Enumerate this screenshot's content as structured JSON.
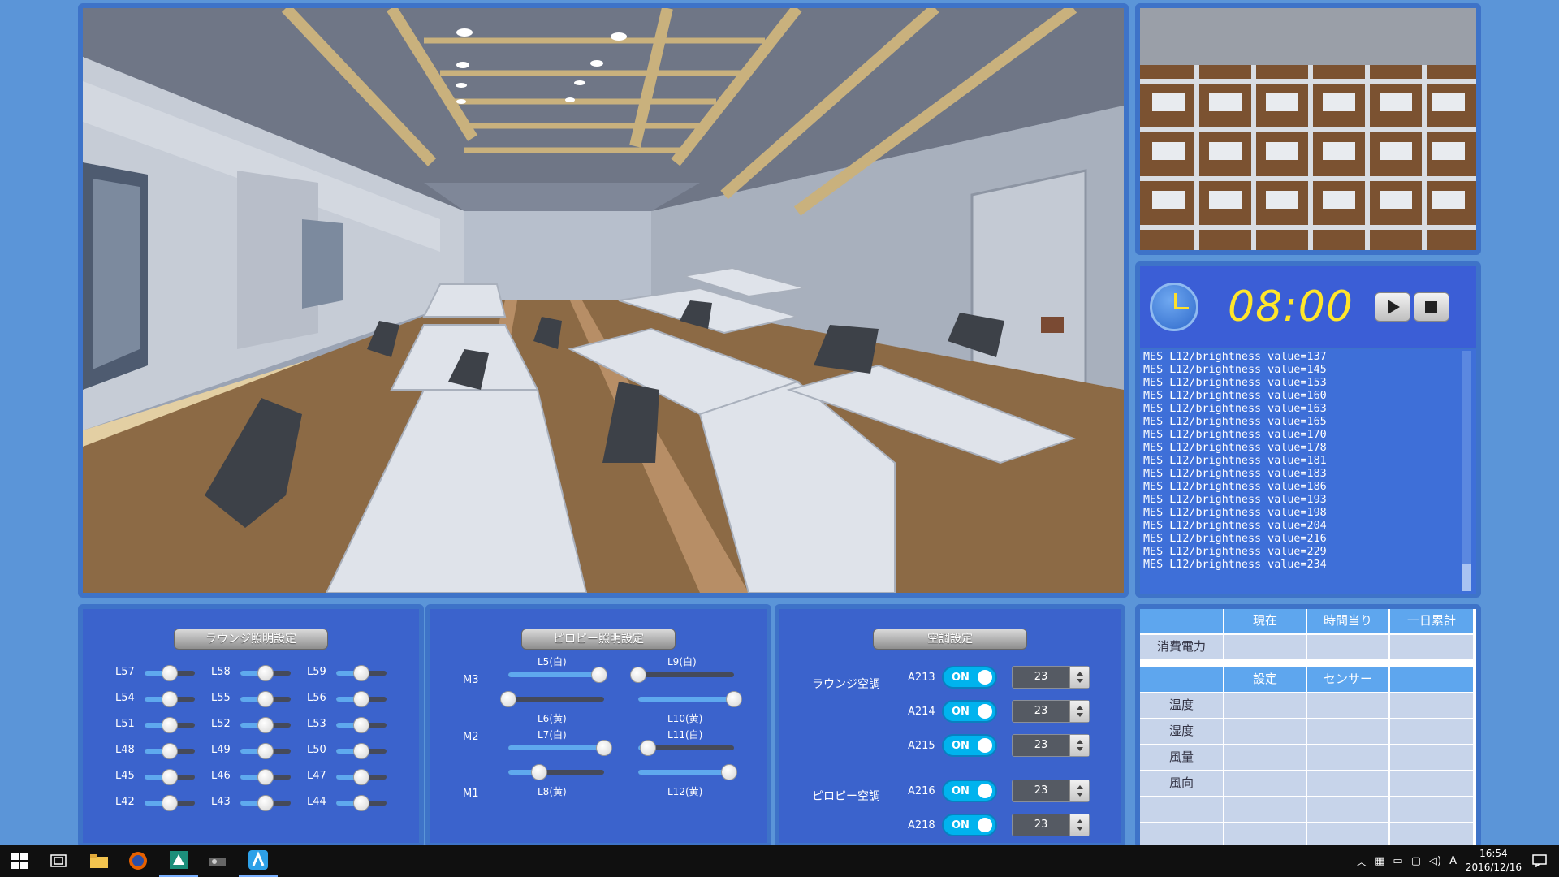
{
  "clock": {
    "time": "08:00"
  },
  "log": {
    "lines": [
      "MES L12/brightness value=137",
      "MES L12/brightness value=145",
      "MES L12/brightness value=153",
      "MES L12/brightness value=160",
      "MES L12/brightness value=163",
      "MES L12/brightness value=165",
      "MES L12/brightness value=170",
      "MES L12/brightness value=178",
      "MES L12/brightness value=181",
      "MES L12/brightness value=183",
      "MES L12/brightness value=186",
      "MES L12/brightness value=193",
      "MES L12/brightness value=198",
      "MES L12/brightness value=204",
      "MES L12/brightness value=216",
      "MES L12/brightness value=229",
      "MES L12/brightness value=234"
    ]
  },
  "lounge_lighting": {
    "title": "ラウンジ照明設定",
    "sliders": [
      {
        "label": "L57",
        "value": 0.5
      },
      {
        "label": "L58",
        "value": 0.5
      },
      {
        "label": "L59",
        "value": 0.5
      },
      {
        "label": "L54",
        "value": 0.5
      },
      {
        "label": "L55",
        "value": 0.5
      },
      {
        "label": "L56",
        "value": 0.5
      },
      {
        "label": "L51",
        "value": 0.5
      },
      {
        "label": "L52",
        "value": 0.5
      },
      {
        "label": "L53",
        "value": 0.5
      },
      {
        "label": "L48",
        "value": 0.5
      },
      {
        "label": "L49",
        "value": 0.5
      },
      {
        "label": "L50",
        "value": 0.5
      },
      {
        "label": "L45",
        "value": 0.5
      },
      {
        "label": "L46",
        "value": 0.5
      },
      {
        "label": "L47",
        "value": 0.5
      },
      {
        "label": "L42",
        "value": 0.5
      },
      {
        "label": "L43",
        "value": 0.5
      },
      {
        "label": "L44",
        "value": 0.5
      }
    ]
  },
  "piloti_lighting": {
    "title": "ピロピー照明設定",
    "rows": [
      "M3",
      "M2",
      "M1"
    ],
    "sliders": [
      {
        "label": "L5(白)",
        "value": 0.95
      },
      {
        "label": "L9(白)",
        "value": 0.0
      },
      {
        "label": "L6(黄)",
        "value": 0.0
      },
      {
        "label": "L10(黄)",
        "value": 1.0
      },
      {
        "label": "L7(白)",
        "value": 1.0
      },
      {
        "label": "L11(白)",
        "value": 0.1
      },
      {
        "label": "L8(黄)",
        "value": 0.32
      },
      {
        "label": "L12(黄)",
        "value": 0.95
      }
    ]
  },
  "aircon": {
    "title": "空調設定",
    "group_lounge": "ラウンジ空調",
    "group_piloti": "ピロピー空調",
    "units": [
      {
        "id": "A213",
        "state": "ON",
        "temp": "23"
      },
      {
        "id": "A214",
        "state": "ON",
        "temp": "23"
      },
      {
        "id": "A215",
        "state": "ON",
        "temp": "23"
      },
      {
        "id": "A216",
        "state": "ON",
        "temp": "23"
      },
      {
        "id": "A218",
        "state": "ON",
        "temp": "23"
      }
    ]
  },
  "table": {
    "header1": [
      "現在",
      "時間当り",
      "一日累計"
    ],
    "row_power": "消費電力",
    "header2": [
      "設定",
      "センサー"
    ],
    "rows": [
      "温度",
      "湿度",
      "風量",
      "風向"
    ]
  },
  "taskbar": {
    "time": "16:54",
    "date": "2016/12/16",
    "ime": "A"
  }
}
